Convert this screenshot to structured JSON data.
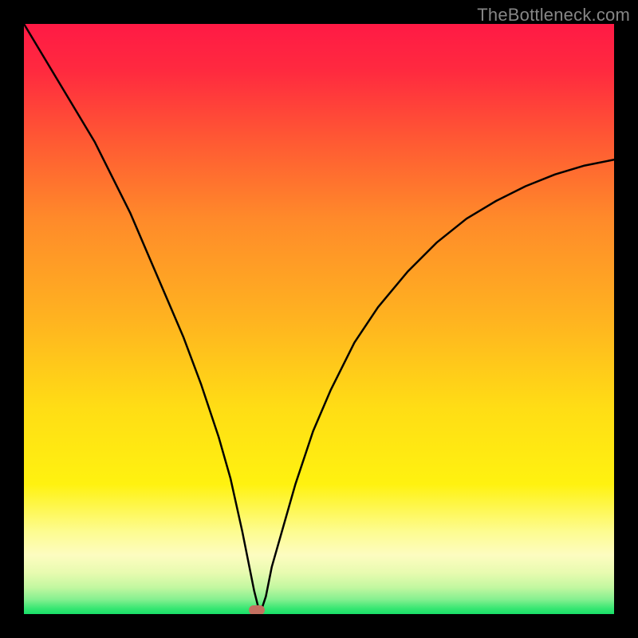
{
  "watermark": "TheBottleneck.com",
  "gradient_stops": [
    {
      "offset": 0.0,
      "color": "#ff1a45"
    },
    {
      "offset": 0.08,
      "color": "#ff2a3f"
    },
    {
      "offset": 0.2,
      "color": "#ff5a33"
    },
    {
      "offset": 0.33,
      "color": "#ff8a2a"
    },
    {
      "offset": 0.5,
      "color": "#ffb320"
    },
    {
      "offset": 0.65,
      "color": "#ffdd15"
    },
    {
      "offset": 0.78,
      "color": "#fff210"
    },
    {
      "offset": 0.86,
      "color": "#fdfc90"
    },
    {
      "offset": 0.9,
      "color": "#fdfcc0"
    },
    {
      "offset": 0.93,
      "color": "#e8fbb0"
    },
    {
      "offset": 0.955,
      "color": "#c2f7a0"
    },
    {
      "offset": 0.975,
      "color": "#86f090"
    },
    {
      "offset": 0.99,
      "color": "#3ae773"
    },
    {
      "offset": 1.0,
      "color": "#18df68"
    }
  ],
  "marker": {
    "x_frac": 0.395,
    "y_frac": 0.993,
    "color": "#c47060"
  },
  "chart_data": {
    "type": "line",
    "title": "",
    "xlabel": "",
    "ylabel": "",
    "xlim": [
      0,
      100
    ],
    "ylim": [
      0,
      100
    ],
    "series": [
      {
        "name": "bottleneck-curve",
        "x": [
          0,
          3,
          6,
          9,
          12,
          15,
          18,
          21,
          24,
          27,
          30,
          33,
          35,
          37,
          39,
          40,
          41,
          42,
          44,
          46,
          49,
          52,
          56,
          60,
          65,
          70,
          75,
          80,
          85,
          90,
          95,
          100
        ],
        "values": [
          100,
          95,
          90,
          85,
          80,
          74,
          68,
          61,
          54,
          47,
          39,
          30,
          23,
          14,
          4,
          0,
          3,
          8,
          15,
          22,
          31,
          38,
          46,
          52,
          58,
          63,
          67,
          70,
          72.5,
          74.5,
          76,
          77
        ]
      }
    ],
    "marker_point": {
      "x": 40,
      "y": 0
    },
    "annotations": [
      {
        "text": "TheBottleneck.com",
        "role": "watermark"
      }
    ]
  }
}
